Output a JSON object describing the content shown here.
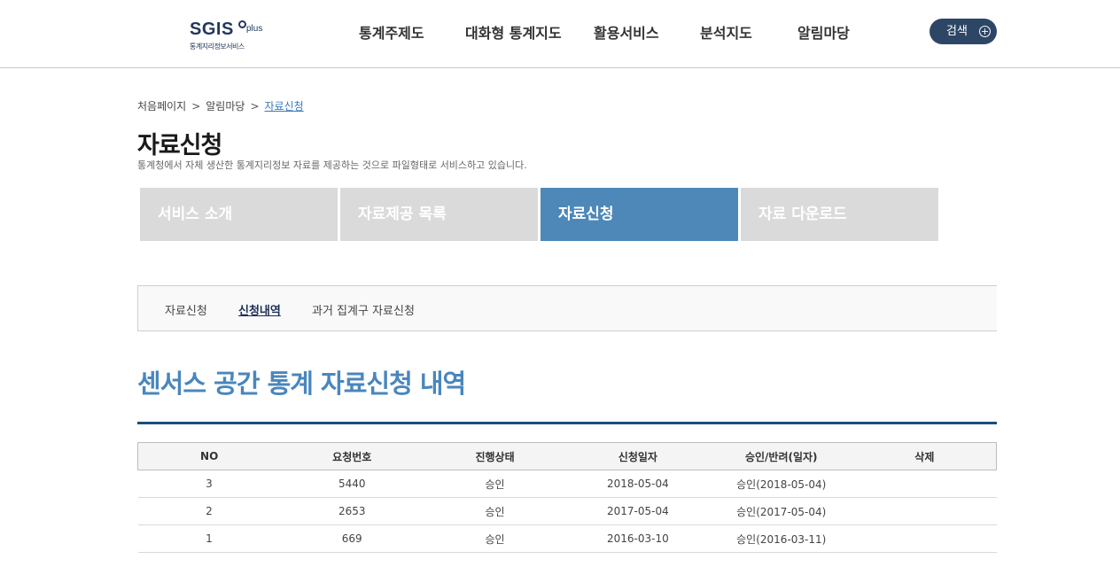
{
  "header": {
    "logo": {
      "main": "SGIS",
      "sup": "plus",
      "sub": "통계지리정보서비스"
    },
    "nav": [
      "통계주제도",
      "대화형 통계지도",
      "활용서비스",
      "분석지도",
      "알림마당"
    ],
    "search_label": "검색"
  },
  "breadcrumb": [
    "처음페이지",
    "알림마당",
    "자료신청"
  ],
  "page": {
    "title": "자료신청",
    "description": "통계청에서 자체 생산한 통계지리정보 자료를 제공하는 것으로 파일형태로 서비스하고 있습니다."
  },
  "tabs": [
    {
      "label": "서비스 소개",
      "active": false
    },
    {
      "label": "자료제공 목록",
      "active": false
    },
    {
      "label": "자료신청",
      "active": true
    },
    {
      "label": "자료 다운로드",
      "active": false
    }
  ],
  "subnav": [
    {
      "label": "자료신청",
      "active": false
    },
    {
      "label": "신청내역",
      "active": true
    },
    {
      "label": "과거 집계구 자료신청",
      "active": false
    }
  ],
  "section_title": "센서스 공간 통계 자료신청 내역",
  "table": {
    "headers": [
      "NO",
      "요청번호",
      "진행상태",
      "신청일자",
      "승인/반려(일자)",
      "삭제"
    ],
    "rows": [
      [
        "3",
        "5440",
        "승인",
        "2018-05-04",
        "승인(2018-05-04)",
        ""
      ],
      [
        "2",
        "2653",
        "승인",
        "2017-05-04",
        "승인(2017-05-04)",
        ""
      ],
      [
        "1",
        "669",
        "승인",
        "2016-03-10",
        "승인(2016-03-11)",
        ""
      ]
    ]
  },
  "colors": {
    "accent": "#4d88b8",
    "navy": "#1e4c7e",
    "search_bg": "#2d4665",
    "tab_inactive": "#dadada"
  }
}
